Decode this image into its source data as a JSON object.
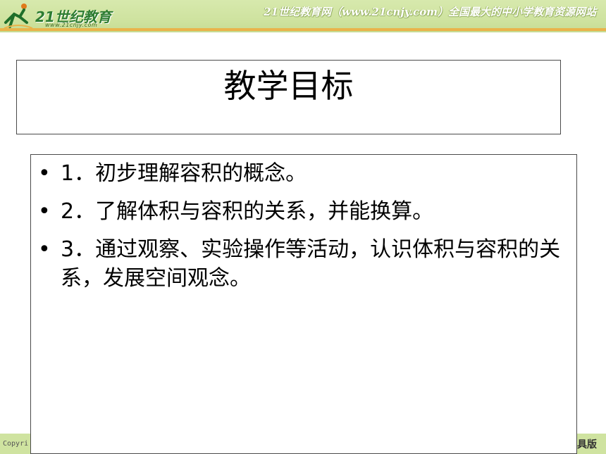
{
  "header": {
    "logo_text": "21世纪教育",
    "logo_url": "www.21cnjy.com",
    "slogan": "21世纪教育网（www.21cnjy.com）全国最大的中小学教育资源网站",
    "colors": {
      "banner": "#cfe3a0",
      "stripe": "#e9b34a",
      "logo": "#2e7d32"
    }
  },
  "slide": {
    "title": "教学目标",
    "bullet_symbol": "•",
    "bullets": [
      "1．初步理解容积的概念。",
      "2．了解体积与容积的关系，并能换算。",
      "3．通过观察、实验操作等活动，认识体积与容积的关系，发展空间观念。"
    ]
  },
  "footer": {
    "left_text": "Copyri",
    "right_text": "具版"
  }
}
